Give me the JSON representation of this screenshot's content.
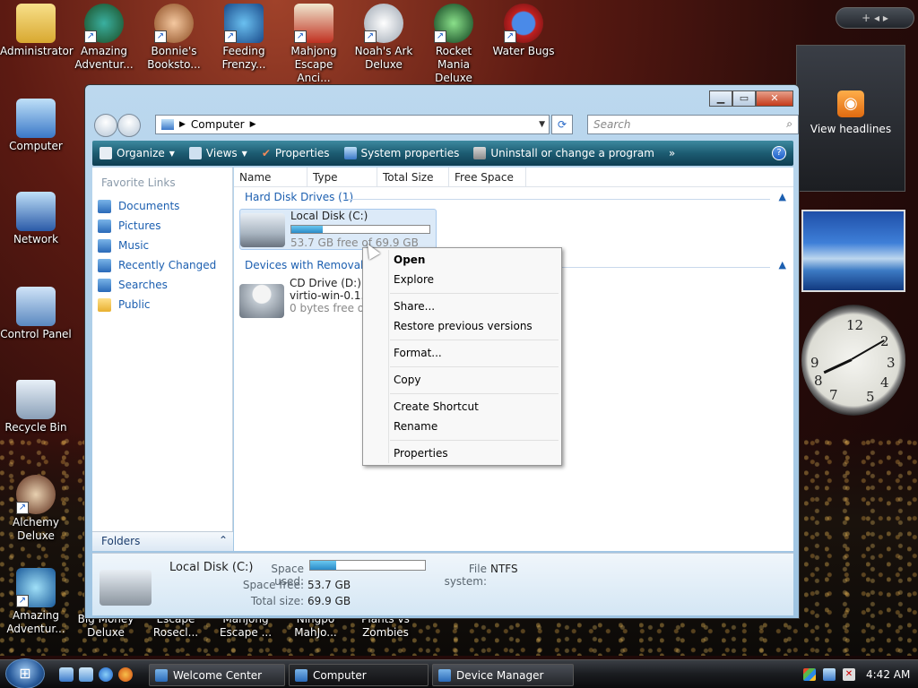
{
  "desktop": {
    "icons": [
      {
        "label": "Administrator"
      },
      {
        "label": "Amazing Adventur..."
      },
      {
        "label": "Bonnie's Booksto..."
      },
      {
        "label": "Feeding Frenzy..."
      },
      {
        "label": "Mahjong Escape Anci..."
      },
      {
        "label": "Noah's Ark Deluxe"
      },
      {
        "label": "Rocket Mania Deluxe"
      },
      {
        "label": "Water Bugs"
      },
      {
        "label": "Computer"
      },
      {
        "label": "Network"
      },
      {
        "label": "Control Panel"
      },
      {
        "label": "Recycle Bin"
      },
      {
        "label": "Alchemy Deluxe"
      },
      {
        "label": "Amazing Adventur..."
      },
      {
        "label": "Big Money Deluxe"
      },
      {
        "label": "Escape Rosecl..."
      },
      {
        "label": "Mahjong Escape ..."
      },
      {
        "label": "Ningpo MahJo..."
      },
      {
        "label": "Plants vs Zombies"
      }
    ]
  },
  "gadgets": {
    "rss_label": "View headlines",
    "sidebar_controls": "+  ◂ ▸"
  },
  "window": {
    "address": {
      "location": "Computer"
    },
    "search_placeholder": "Search",
    "toolbar": {
      "organize": "Organize",
      "views": "Views",
      "properties": "Properties",
      "system_properties": "System properties",
      "uninstall": "Uninstall or change a program",
      "more": "»"
    },
    "left_pane": {
      "title": "Favorite Links",
      "links": [
        "Documents",
        "Pictures",
        "Music",
        "Recently Changed",
        "Searches",
        "Public"
      ],
      "folders": "Folders"
    },
    "columns": [
      "Name",
      "Type",
      "Total Size",
      "Free Space"
    ],
    "groups": {
      "hard_disk": "Hard Disk Drives (1)",
      "removable": "Devices with Removable"
    },
    "drives": {
      "c": {
        "name": "Local Disk (C:)",
        "free": "53.7 GB free of 69.9 GB",
        "used_fraction": 0.23
      },
      "d": {
        "name": "CD Drive (D:)",
        "label": "virtio-win-0.1.22",
        "free": "0 bytes free of 5"
      }
    },
    "details": {
      "name": "Local Disk (C:)",
      "space_used_label": "Space used:",
      "space_free_label": "Space free:",
      "space_free": "53.7 GB",
      "total_size_label": "Total size:",
      "total_size": "69.9 GB",
      "fs_label": "File system:",
      "fs": "NTFS"
    }
  },
  "context_menu": {
    "open": "Open",
    "explore": "Explore",
    "share": "Share...",
    "restore": "Restore previous versions",
    "format": "Format...",
    "copy": "Copy",
    "create_shortcut": "Create Shortcut",
    "rename": "Rename",
    "properties": "Properties"
  },
  "taskbar": {
    "buttons": [
      "Welcome Center",
      "Computer",
      "Device Manager"
    ],
    "time": "4:42 AM"
  }
}
